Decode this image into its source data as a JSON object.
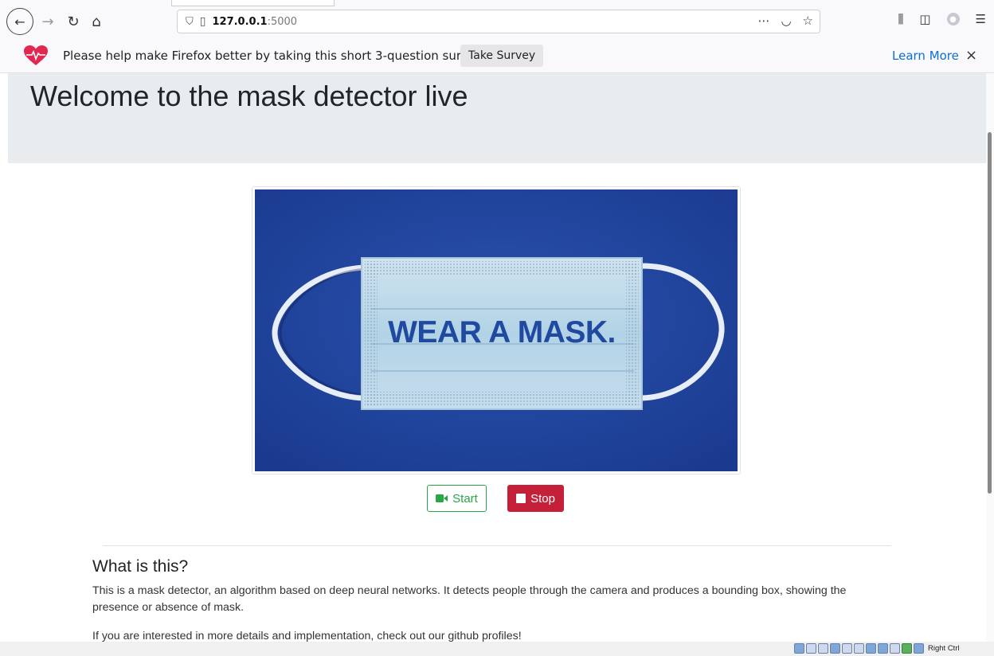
{
  "browser": {
    "url_host": "127.0.0.1",
    "url_port": ":5000"
  },
  "notification": {
    "message": "Please help make Firefox better by taking this short 3-question survey",
    "survey_button": "Take Survey",
    "learn_more": "Learn More",
    "close": "×"
  },
  "page": {
    "title": "Welcome to the mask detector live",
    "video_text": "WEAR A MASK.",
    "start_label": "Start",
    "stop_label": "Stop",
    "section_title": "What is this?",
    "paragraph1": "This is a mask detector, an algorithm based on deep neural networks. It detects people through the camera and produces a bounding box, showing the presence or absence of mask.",
    "paragraph2": "If you are interested in more details and implementation, check out our github profiles!"
  },
  "statusbar": {
    "host_key": "Right Ctrl"
  },
  "colors": {
    "start_green": "#28a745",
    "stop_red": "#c5203a",
    "mask_background": "#1d3f98",
    "link_blue": "#0a6fd8"
  }
}
